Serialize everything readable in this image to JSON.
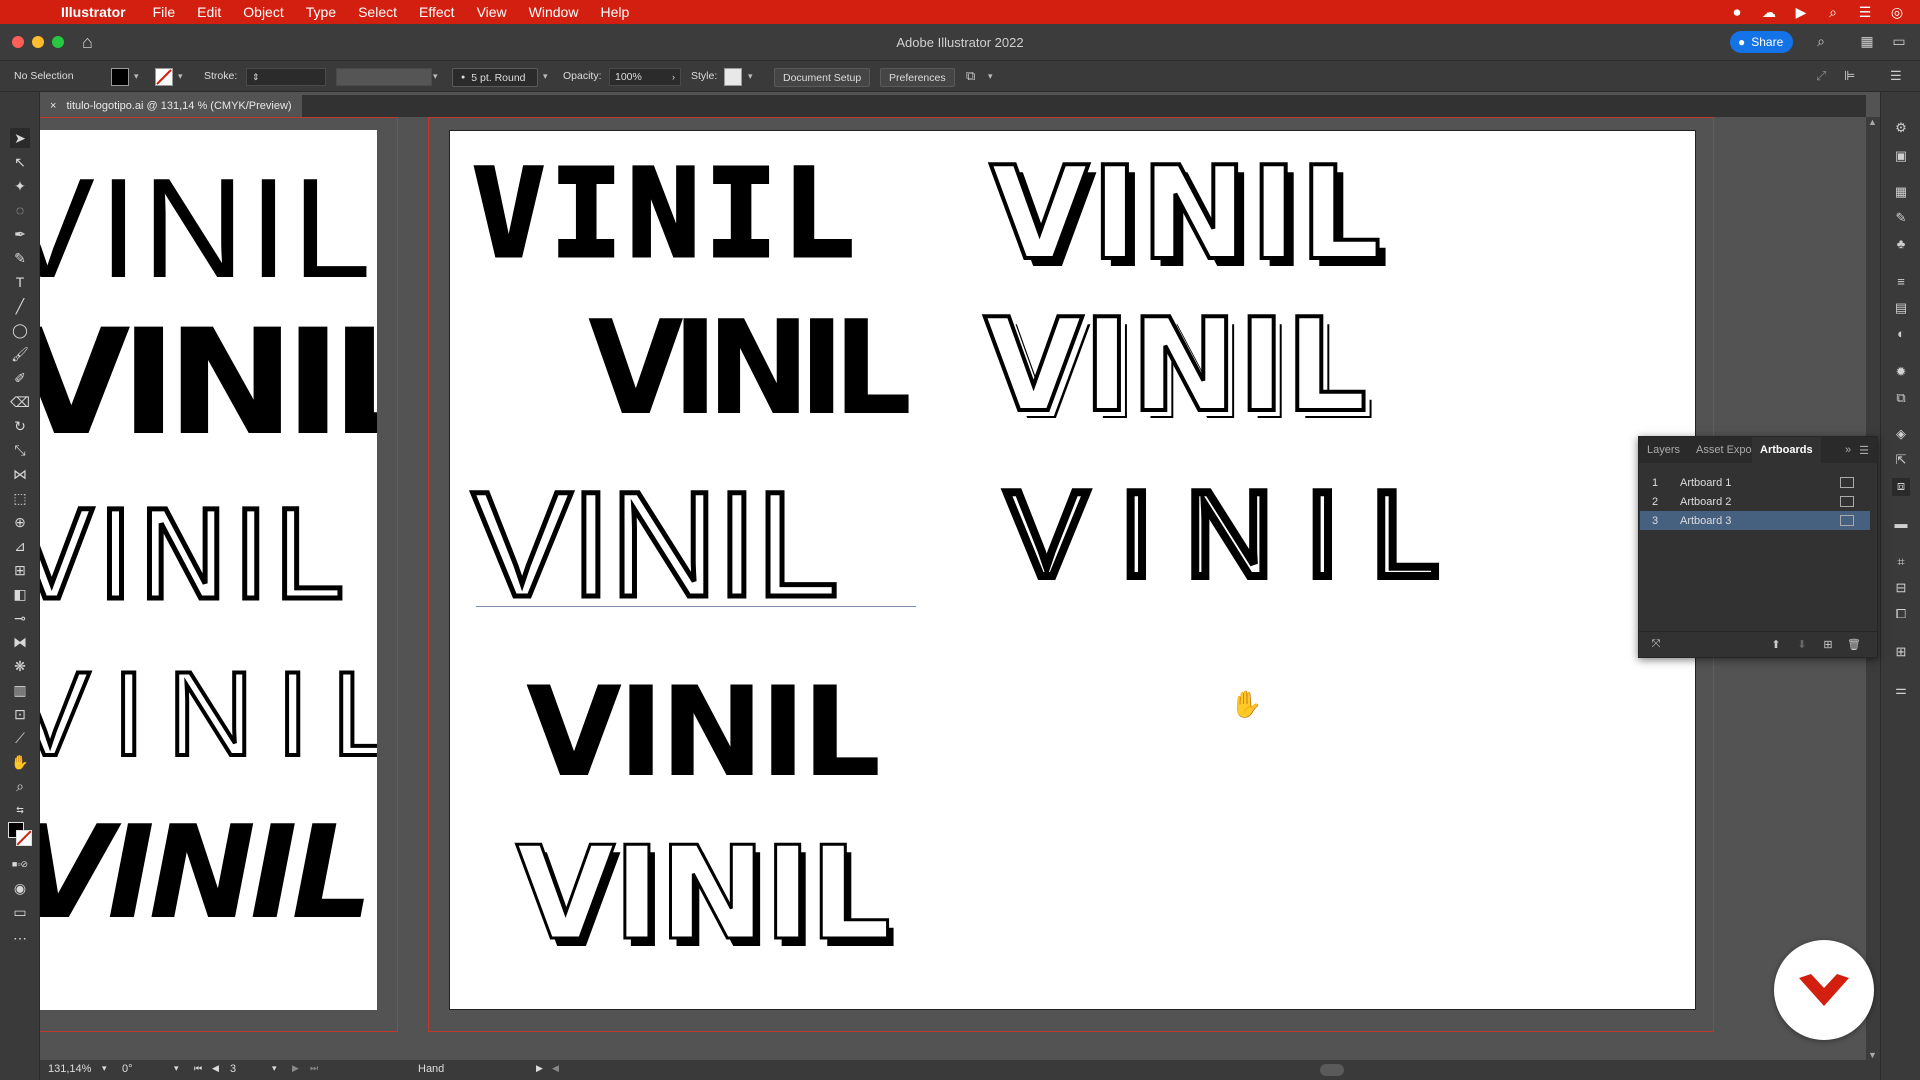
{
  "menubar": {
    "app": "Illustrator",
    "items": [
      "File",
      "Edit",
      "Object",
      "Type",
      "Select",
      "Effect",
      "View",
      "Window",
      "Help"
    ]
  },
  "titlebar": {
    "title": "Adobe Illustrator 2022",
    "share_label": "Share"
  },
  "controlbar": {
    "selection": "No Selection",
    "stroke_label": "Stroke:",
    "brush": "5 pt. Round",
    "opacity_label": "Opacity:",
    "opacity_value": "100%",
    "style_label": "Style:",
    "document_setup": "Document Setup",
    "preferences": "Preferences"
  },
  "document": {
    "tab_title": "titulo-logotipo.ai @ 131,14 % (CMYK/Preview)",
    "close_glyph": "×"
  },
  "canvas": {
    "left_words": [
      "VINIL",
      "VINIL",
      "VINIL",
      "VINIL",
      "VINIL"
    ],
    "main_words": [
      "VINIL",
      "VINIL",
      "VINIL",
      "VINIL",
      "VINIL",
      "VINIL",
      "VINIL",
      "VINIL"
    ]
  },
  "panel": {
    "tabs": [
      "Layers",
      "Asset Expo",
      "Artboards"
    ],
    "active_tab": "Artboards",
    "rows": [
      {
        "num": "1",
        "name": "Artboard 1"
      },
      {
        "num": "2",
        "name": "Artboard 2"
      },
      {
        "num": "3",
        "name": "Artboard 3"
      }
    ],
    "selected_row": 3
  },
  "statusbar": {
    "zoom": "131,14%",
    "rotation": "0°",
    "artboard_num": "3",
    "tool": "Hand"
  },
  "colors": {
    "menubar": "#d21f0f",
    "share": "#1473e6",
    "selection_row": "#46607f",
    "bleed": "#c0392b",
    "badge_logo": "#d21f0f"
  }
}
